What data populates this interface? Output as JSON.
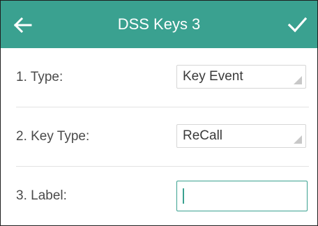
{
  "header": {
    "title": "DSS Keys 3",
    "back_icon": "arrow-left-icon",
    "confirm_icon": "checkmark-icon",
    "bg_color": "#3aa190"
  },
  "fields": {
    "type": {
      "label": "1. Type:",
      "value": "Key Event"
    },
    "key_type": {
      "label": "2. Key Type:",
      "value": "ReCall"
    },
    "label": {
      "label": "3. Label:",
      "value": ""
    }
  },
  "colors": {
    "accent": "#3aa190",
    "text": "#4a4a4a",
    "divider": "#e2e2e2"
  }
}
